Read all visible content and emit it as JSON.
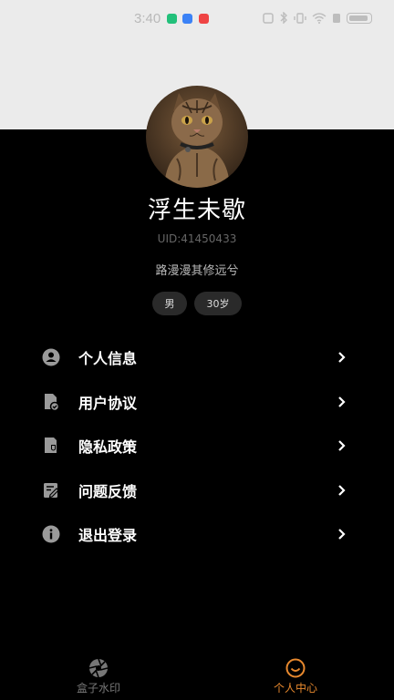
{
  "status_bar": {
    "time": "3:40"
  },
  "profile": {
    "name": "浮生未歇",
    "uid": "UID:41450433",
    "signature": "路漫漫其修远兮",
    "tags": [
      "男",
      "30岁"
    ]
  },
  "menu": {
    "items": [
      {
        "label": "个人信息",
        "icon": "person-icon"
      },
      {
        "label": "用户协议",
        "icon": "agreement-icon"
      },
      {
        "label": "隐私政策",
        "icon": "privacy-icon"
      },
      {
        "label": "问题反馈",
        "icon": "feedback-icon"
      },
      {
        "label": "退出登录",
        "icon": "info-icon"
      }
    ]
  },
  "tabbar": {
    "tabs": [
      {
        "label": "盒子水印",
        "icon": "aperture-icon",
        "active": false
      },
      {
        "label": "个人中心",
        "icon": "smile-icon",
        "active": true
      }
    ]
  },
  "colors": {
    "accent": "#e8892e",
    "background": "#000000",
    "header_band": "#ebebeb",
    "tag_bg": "#2a2a2a"
  }
}
